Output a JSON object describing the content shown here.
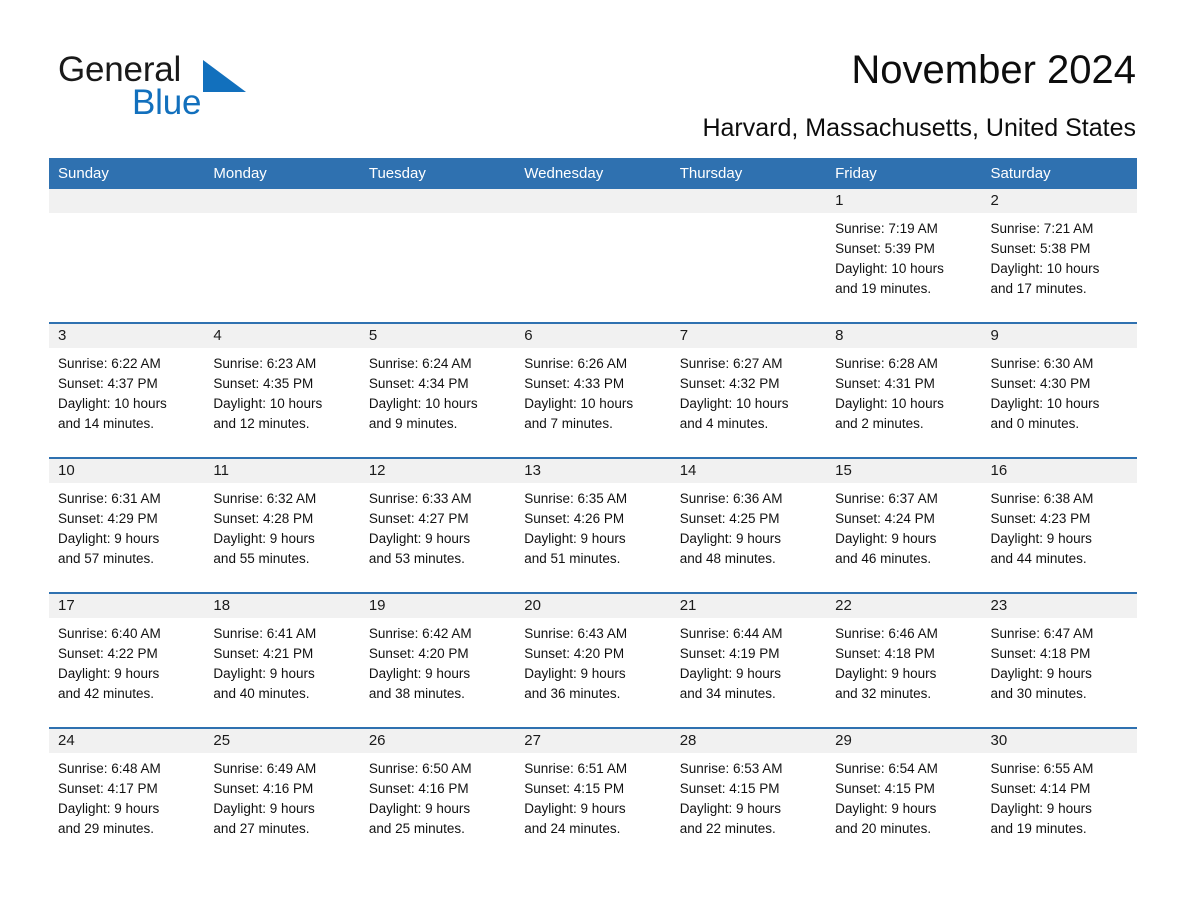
{
  "brand": {
    "name_part1": "General",
    "name_part2": "Blue",
    "accent_color": "#1270bd",
    "triangle_icon": "triangle-icon"
  },
  "header": {
    "title": "November 2024",
    "subtitle": "Harvard, Massachusetts, United States"
  },
  "calendar": {
    "header_color": "#2f71b0",
    "daynum_band_color": "#f1f1f1",
    "weekdays": [
      "Sunday",
      "Monday",
      "Tuesday",
      "Wednesday",
      "Thursday",
      "Friday",
      "Saturday"
    ],
    "weeks": [
      [
        {
          "empty": true
        },
        {
          "empty": true
        },
        {
          "empty": true
        },
        {
          "empty": true
        },
        {
          "empty": true
        },
        {
          "day": "1",
          "sunrise": "Sunrise: 7:19 AM",
          "sunset": "Sunset: 5:39 PM",
          "daylight_line1": "Daylight: 10 hours",
          "daylight_line2": "and 19 minutes."
        },
        {
          "day": "2",
          "sunrise": "Sunrise: 7:21 AM",
          "sunset": "Sunset: 5:38 PM",
          "daylight_line1": "Daylight: 10 hours",
          "daylight_line2": "and 17 minutes."
        }
      ],
      [
        {
          "day": "3",
          "sunrise": "Sunrise: 6:22 AM",
          "sunset": "Sunset: 4:37 PM",
          "daylight_line1": "Daylight: 10 hours",
          "daylight_line2": "and 14 minutes."
        },
        {
          "day": "4",
          "sunrise": "Sunrise: 6:23 AM",
          "sunset": "Sunset: 4:35 PM",
          "daylight_line1": "Daylight: 10 hours",
          "daylight_line2": "and 12 minutes."
        },
        {
          "day": "5",
          "sunrise": "Sunrise: 6:24 AM",
          "sunset": "Sunset: 4:34 PM",
          "daylight_line1": "Daylight: 10 hours",
          "daylight_line2": "and 9 minutes."
        },
        {
          "day": "6",
          "sunrise": "Sunrise: 6:26 AM",
          "sunset": "Sunset: 4:33 PM",
          "daylight_line1": "Daylight: 10 hours",
          "daylight_line2": "and 7 minutes."
        },
        {
          "day": "7",
          "sunrise": "Sunrise: 6:27 AM",
          "sunset": "Sunset: 4:32 PM",
          "daylight_line1": "Daylight: 10 hours",
          "daylight_line2": "and 4 minutes."
        },
        {
          "day": "8",
          "sunrise": "Sunrise: 6:28 AM",
          "sunset": "Sunset: 4:31 PM",
          "daylight_line1": "Daylight: 10 hours",
          "daylight_line2": "and 2 minutes."
        },
        {
          "day": "9",
          "sunrise": "Sunrise: 6:30 AM",
          "sunset": "Sunset: 4:30 PM",
          "daylight_line1": "Daylight: 10 hours",
          "daylight_line2": "and 0 minutes."
        }
      ],
      [
        {
          "day": "10",
          "sunrise": "Sunrise: 6:31 AM",
          "sunset": "Sunset: 4:29 PM",
          "daylight_line1": "Daylight: 9 hours",
          "daylight_line2": "and 57 minutes."
        },
        {
          "day": "11",
          "sunrise": "Sunrise: 6:32 AM",
          "sunset": "Sunset: 4:28 PM",
          "daylight_line1": "Daylight: 9 hours",
          "daylight_line2": "and 55 minutes."
        },
        {
          "day": "12",
          "sunrise": "Sunrise: 6:33 AM",
          "sunset": "Sunset: 4:27 PM",
          "daylight_line1": "Daylight: 9 hours",
          "daylight_line2": "and 53 minutes."
        },
        {
          "day": "13",
          "sunrise": "Sunrise: 6:35 AM",
          "sunset": "Sunset: 4:26 PM",
          "daylight_line1": "Daylight: 9 hours",
          "daylight_line2": "and 51 minutes."
        },
        {
          "day": "14",
          "sunrise": "Sunrise: 6:36 AM",
          "sunset": "Sunset: 4:25 PM",
          "daylight_line1": "Daylight: 9 hours",
          "daylight_line2": "and 48 minutes."
        },
        {
          "day": "15",
          "sunrise": "Sunrise: 6:37 AM",
          "sunset": "Sunset: 4:24 PM",
          "daylight_line1": "Daylight: 9 hours",
          "daylight_line2": "and 46 minutes."
        },
        {
          "day": "16",
          "sunrise": "Sunrise: 6:38 AM",
          "sunset": "Sunset: 4:23 PM",
          "daylight_line1": "Daylight: 9 hours",
          "daylight_line2": "and 44 minutes."
        }
      ],
      [
        {
          "day": "17",
          "sunrise": "Sunrise: 6:40 AM",
          "sunset": "Sunset: 4:22 PM",
          "daylight_line1": "Daylight: 9 hours",
          "daylight_line2": "and 42 minutes."
        },
        {
          "day": "18",
          "sunrise": "Sunrise: 6:41 AM",
          "sunset": "Sunset: 4:21 PM",
          "daylight_line1": "Daylight: 9 hours",
          "daylight_line2": "and 40 minutes."
        },
        {
          "day": "19",
          "sunrise": "Sunrise: 6:42 AM",
          "sunset": "Sunset: 4:20 PM",
          "daylight_line1": "Daylight: 9 hours",
          "daylight_line2": "and 38 minutes."
        },
        {
          "day": "20",
          "sunrise": "Sunrise: 6:43 AM",
          "sunset": "Sunset: 4:20 PM",
          "daylight_line1": "Daylight: 9 hours",
          "daylight_line2": "and 36 minutes."
        },
        {
          "day": "21",
          "sunrise": "Sunrise: 6:44 AM",
          "sunset": "Sunset: 4:19 PM",
          "daylight_line1": "Daylight: 9 hours",
          "daylight_line2": "and 34 minutes."
        },
        {
          "day": "22",
          "sunrise": "Sunrise: 6:46 AM",
          "sunset": "Sunset: 4:18 PM",
          "daylight_line1": "Daylight: 9 hours",
          "daylight_line2": "and 32 minutes."
        },
        {
          "day": "23",
          "sunrise": "Sunrise: 6:47 AM",
          "sunset": "Sunset: 4:18 PM",
          "daylight_line1": "Daylight: 9 hours",
          "daylight_line2": "and 30 minutes."
        }
      ],
      [
        {
          "day": "24",
          "sunrise": "Sunrise: 6:48 AM",
          "sunset": "Sunset: 4:17 PM",
          "daylight_line1": "Daylight: 9 hours",
          "daylight_line2": "and 29 minutes."
        },
        {
          "day": "25",
          "sunrise": "Sunrise: 6:49 AM",
          "sunset": "Sunset: 4:16 PM",
          "daylight_line1": "Daylight: 9 hours",
          "daylight_line2": "and 27 minutes."
        },
        {
          "day": "26",
          "sunrise": "Sunrise: 6:50 AM",
          "sunset": "Sunset: 4:16 PM",
          "daylight_line1": "Daylight: 9 hours",
          "daylight_line2": "and 25 minutes."
        },
        {
          "day": "27",
          "sunrise": "Sunrise: 6:51 AM",
          "sunset": "Sunset: 4:15 PM",
          "daylight_line1": "Daylight: 9 hours",
          "daylight_line2": "and 24 minutes."
        },
        {
          "day": "28",
          "sunrise": "Sunrise: 6:53 AM",
          "sunset": "Sunset: 4:15 PM",
          "daylight_line1": "Daylight: 9 hours",
          "daylight_line2": "and 22 minutes."
        },
        {
          "day": "29",
          "sunrise": "Sunrise: 6:54 AM",
          "sunset": "Sunset: 4:15 PM",
          "daylight_line1": "Daylight: 9 hours",
          "daylight_line2": "and 20 minutes."
        },
        {
          "day": "30",
          "sunrise": "Sunrise: 6:55 AM",
          "sunset": "Sunset: 4:14 PM",
          "daylight_line1": "Daylight: 9 hours",
          "daylight_line2": "and 19 minutes."
        }
      ]
    ]
  }
}
